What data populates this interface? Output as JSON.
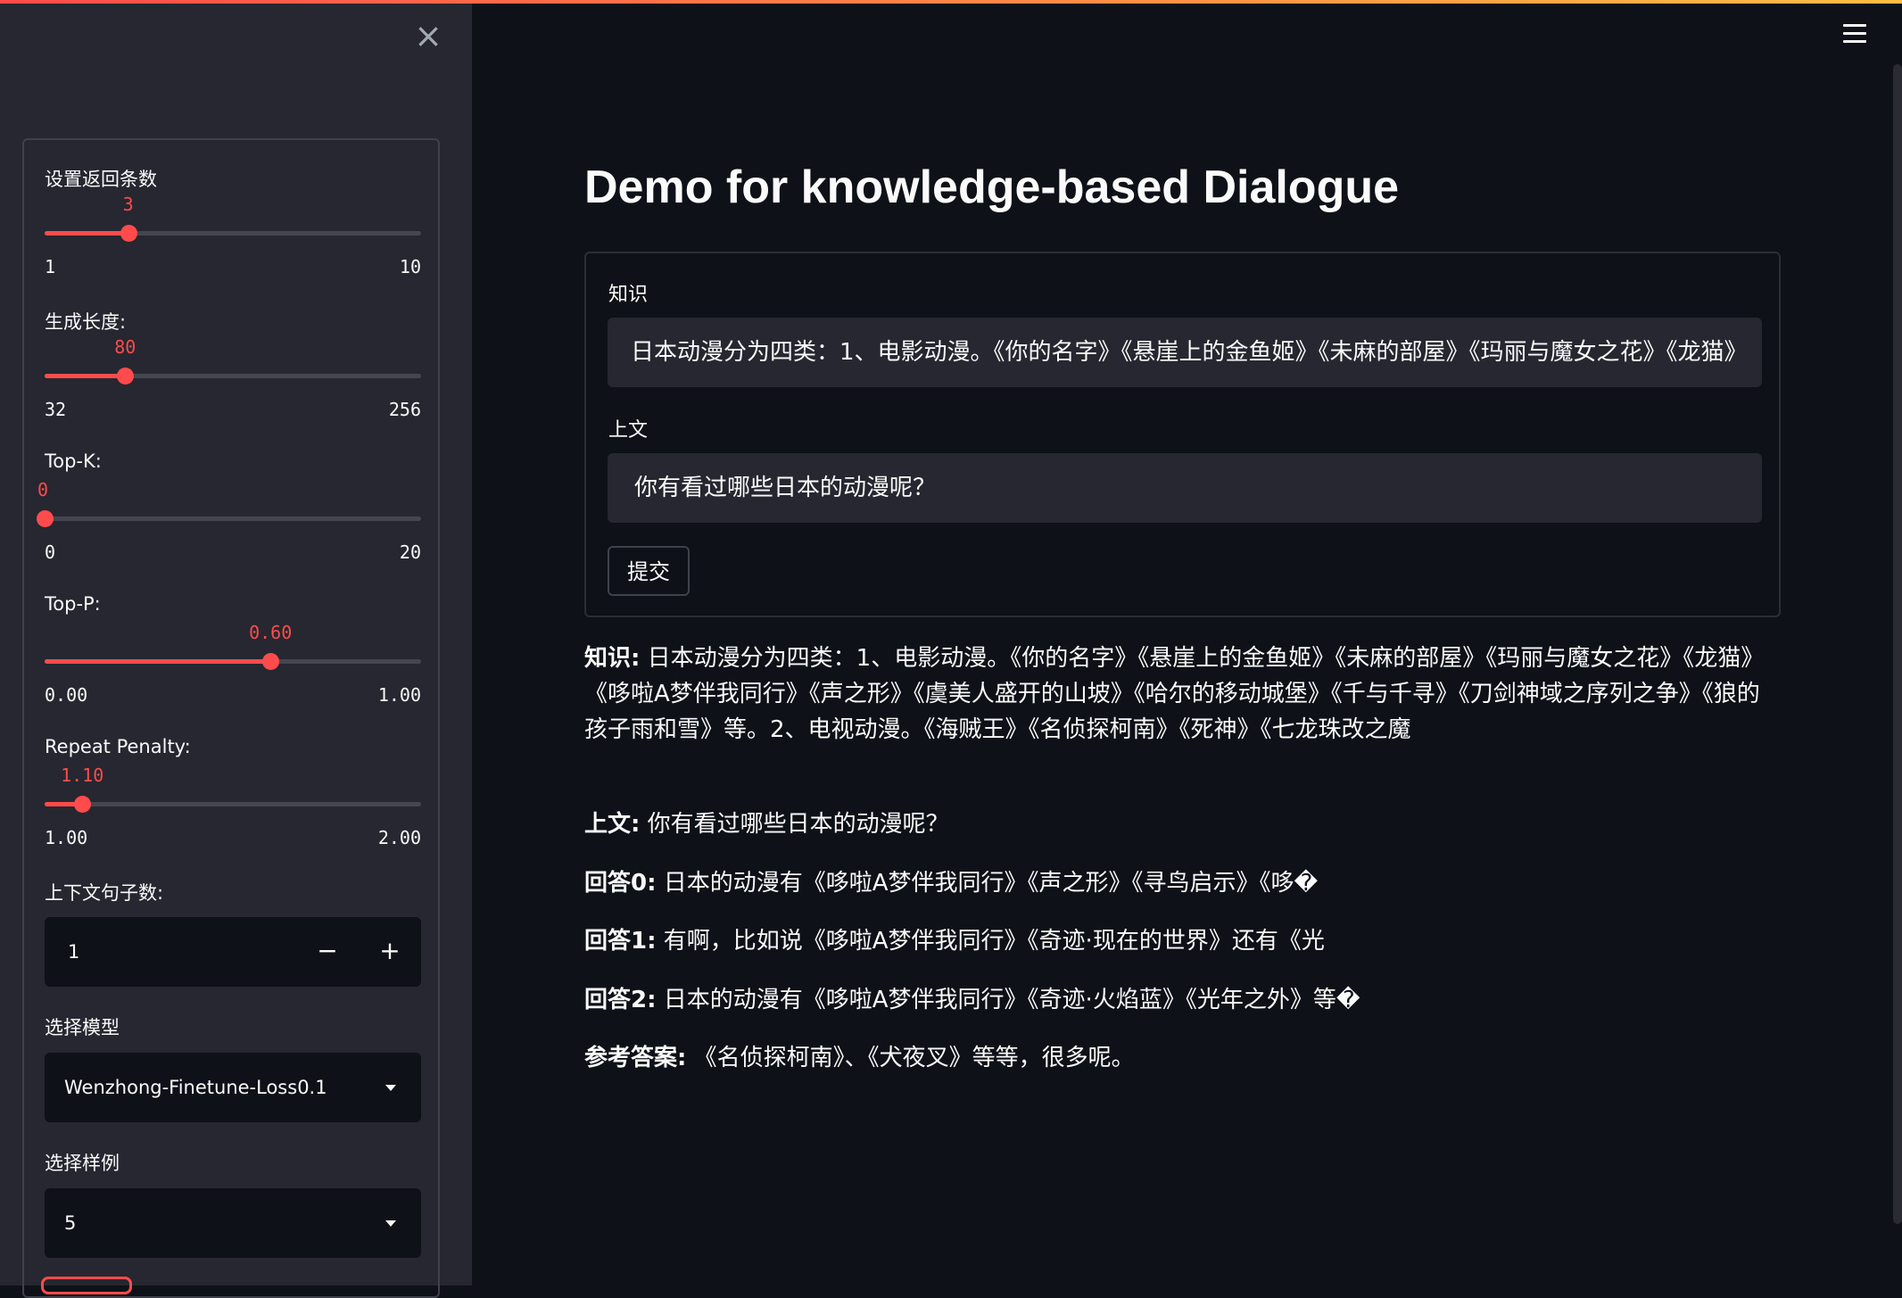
{
  "sidebar": {
    "sliders": [
      {
        "label": "设置返回条数",
        "value": "3",
        "min": "1",
        "max": "10",
        "fraction": 0.222
      },
      {
        "label": "生成长度:",
        "value": "80",
        "min": "32",
        "max": "256",
        "fraction": 0.214
      },
      {
        "label": "Top-K:",
        "value": "0",
        "min": "0",
        "max": "20",
        "fraction": 0.0
      },
      {
        "label": "Top-P:",
        "value": "0.60",
        "min": "0.00",
        "max": "1.00",
        "fraction": 0.6
      },
      {
        "label": "Repeat Penalty:",
        "value": "1.10",
        "min": "1.00",
        "max": "2.00",
        "fraction": 0.1
      }
    ],
    "context_sentences": {
      "label": "上下文句子数:",
      "value": "1",
      "minus": "−",
      "plus": "+"
    },
    "model_select": {
      "label": "选择模型",
      "value": "Wenzhong-Finetune-Loss0.1"
    },
    "example_select": {
      "label": "选择样例",
      "value": "5"
    }
  },
  "main": {
    "title": "Demo for knowledge-based Dialogue",
    "form": {
      "knowledge_label": "知识",
      "knowledge_value": "日本动漫分为四类：1、电影动漫。《你的名字》《悬崖上的金鱼姬》《未麻的部屋》《玛丽与魔女之花》《龙猫》",
      "context_label": "上文",
      "context_value": "你有看过哪些日本的动漫呢？",
      "submit_label": "提交"
    },
    "output": [
      {
        "label": "知识:",
        "text": "日本动漫分为四类：1、电影动漫。《你的名字》《悬崖上的金鱼姬》《未麻的部屋》《玛丽与魔女之花》《龙猫》《哆啦A梦伴我同行》《声之形》《虞美人盛开的山坡》《哈尔的移动城堡》《千与千寻》《刀剑神域之序列之争》《狼的孩子雨和雪》等。2、电视动漫。《海贼王》《名侦探柯南》《死神》《七龙珠改之魔"
      },
      {
        "label": "上文:",
        "text": "你有看过哪些日本的动漫呢？"
      },
      {
        "label": "回答0:",
        "text": "日本的动漫有《哆啦A梦伴我同行》《声之形》《寻鸟启示》《哆�"
      },
      {
        "label": "回答1:",
        "text": "有啊，比如说《哆啦A梦伴我同行》《奇迹·现在的世界》还有《光"
      },
      {
        "label": "回答2:",
        "text": "日本的动漫有《哆啦A梦伴我同行》《奇迹·火焰蓝》《光年之外》等�"
      },
      {
        "label": "参考答案:",
        "text": "《名侦探柯南》、《犬夜叉》等等，很多呢。"
      }
    ]
  },
  "icons": {
    "close": "close-icon",
    "menu": "hamburger-menu-icon",
    "dropdown": "chevron-down-icon"
  },
  "colors": {
    "accent": "#ff4b4b",
    "background": "#0e1117",
    "sidebar": "#262730"
  }
}
